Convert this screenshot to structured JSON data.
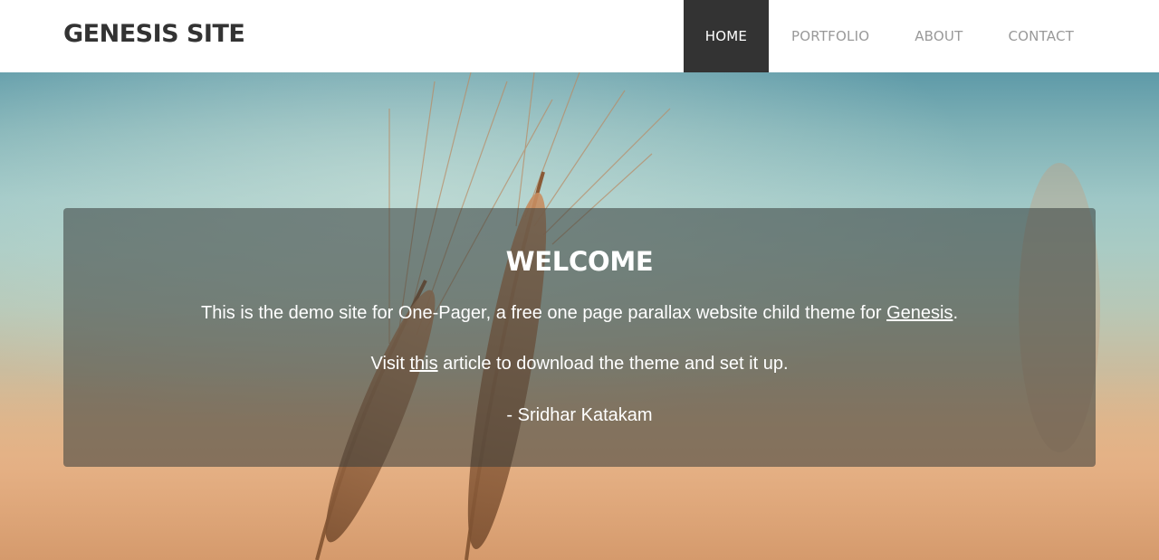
{
  "header": {
    "site_title": "GENESIS SITE",
    "nav": [
      {
        "label": "HOME",
        "active": true
      },
      {
        "label": "PORTFOLIO",
        "active": false
      },
      {
        "label": "ABOUT",
        "active": false
      },
      {
        "label": "CONTACT",
        "active": false
      }
    ]
  },
  "hero": {
    "background": "wheat-field-photo",
    "title": "WELCOME",
    "line1_prefix": "This is the demo site for One-Pager, a free one page parallax website child theme for ",
    "line1_link": "Genesis",
    "line1_suffix": ".",
    "line2_prefix": "Visit ",
    "line2_link": "this",
    "line2_suffix": " article to download the theme and set it up.",
    "signature": "- Sridhar Katakam"
  },
  "colors": {
    "nav_active_bg": "#333333",
    "nav_text": "#999999",
    "title_text": "#333333",
    "overlay": "#373c3a"
  }
}
